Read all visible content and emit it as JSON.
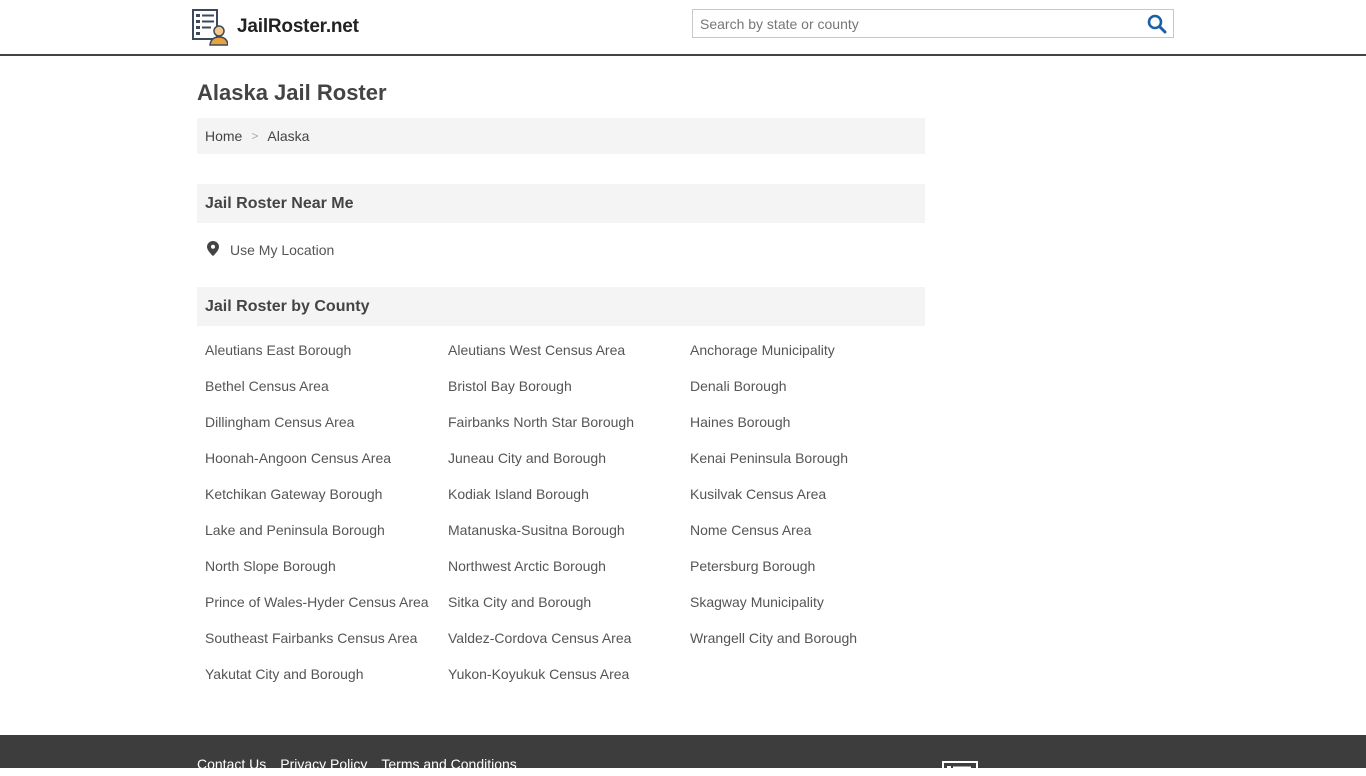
{
  "site": {
    "name": "JailRoster.net"
  },
  "search": {
    "placeholder": "Search by state or county"
  },
  "page": {
    "title": "Alaska Jail Roster"
  },
  "breadcrumb": {
    "home": "Home",
    "separator": ">",
    "current": "Alaska"
  },
  "near_me": {
    "heading": "Jail Roster Near Me",
    "use_location": "Use My Location"
  },
  "county": {
    "heading": "Jail Roster by County",
    "items": [
      "Aleutians East Borough",
      "Aleutians West Census Area",
      "Anchorage Municipality",
      "Bethel Census Area",
      "Bristol Bay Borough",
      "Denali Borough",
      "Dillingham Census Area",
      "Fairbanks North Star Borough",
      "Haines Borough",
      "Hoonah-Angoon Census Area",
      "Juneau City and Borough",
      "Kenai Peninsula Borough",
      "Ketchikan Gateway Borough",
      "Kodiak Island Borough",
      "Kusilvak Census Area",
      "Lake and Peninsula Borough",
      "Matanuska-Susitna Borough",
      "Nome Census Area",
      "North Slope Borough",
      "Northwest Arctic Borough",
      "Petersburg Borough",
      "Prince of Wales-Hyder Census Area",
      "Sitka City and Borough",
      "Skagway Municipality",
      "Southeast Fairbanks Census Area",
      "Valdez-Cordova Census Area",
      "Wrangell City and Borough",
      "Yakutat City and Borough",
      "Yukon-Koyukuk Census Area"
    ]
  },
  "footer": {
    "links": [
      "Contact Us",
      "Privacy Policy",
      "Terms and Conditions"
    ]
  },
  "icons": {
    "logo": "roster-list-person-icon",
    "search": "magnifier-icon",
    "location": "map-pin-icon",
    "footer": "roster-list-icon"
  },
  "colors": {
    "header_border": "#444444",
    "search_icon": "#1a5fa8",
    "panel_bg": "#f4f4f4",
    "footer_bg": "#3d3d3d",
    "logo_accent": "#e8a33d"
  }
}
